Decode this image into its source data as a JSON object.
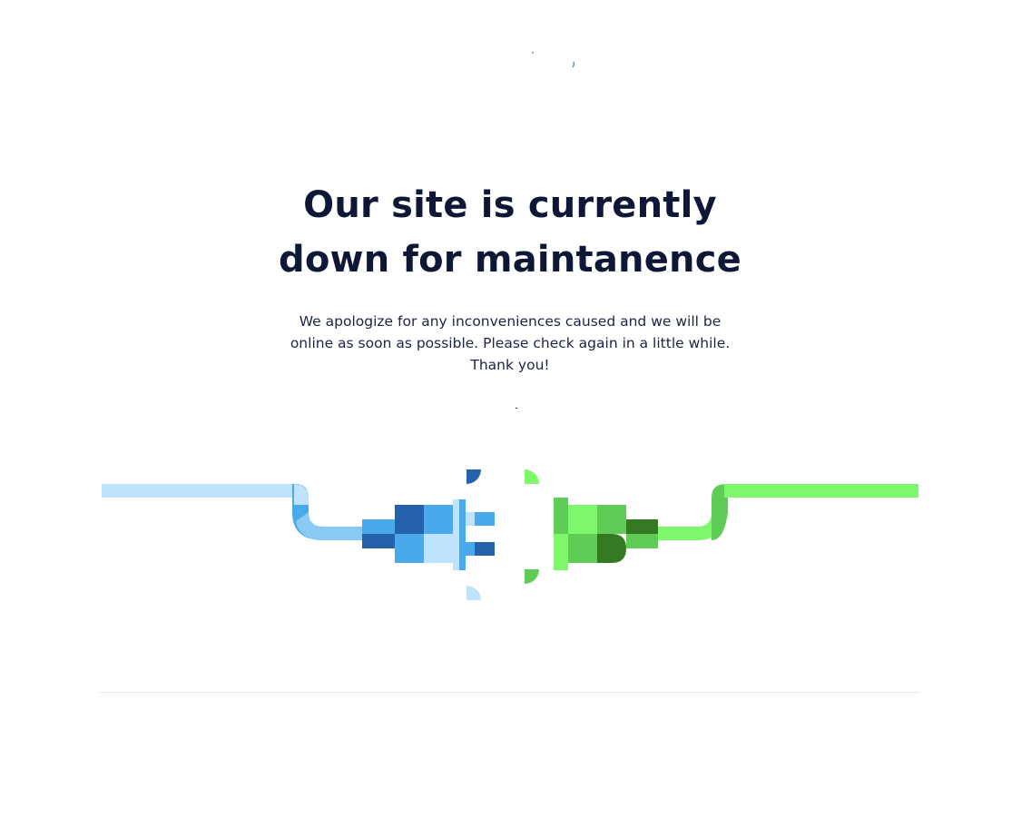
{
  "maintenance": {
    "heading_line1": "Our site is currently",
    "heading_line2": "down for maintanence",
    "message": "We apologize for any inconveniences caused and we will be online as soon as possible. Please check again in a little while. Thank you!"
  },
  "illustration": {
    "icon": "unplugged-cable-icon",
    "colors": {
      "blue_light": "#bfe3fc",
      "blue_mid": "#4aa9ea",
      "blue_dark": "#2661ab",
      "green_light": "#7df76b",
      "green_mid": "#5ecc55",
      "green_dark": "#337a22"
    }
  },
  "colors": {
    "heading": "#0f1737",
    "body_text": "#1d2444",
    "background": "#ffffff",
    "divider": "#e6e8ee"
  }
}
